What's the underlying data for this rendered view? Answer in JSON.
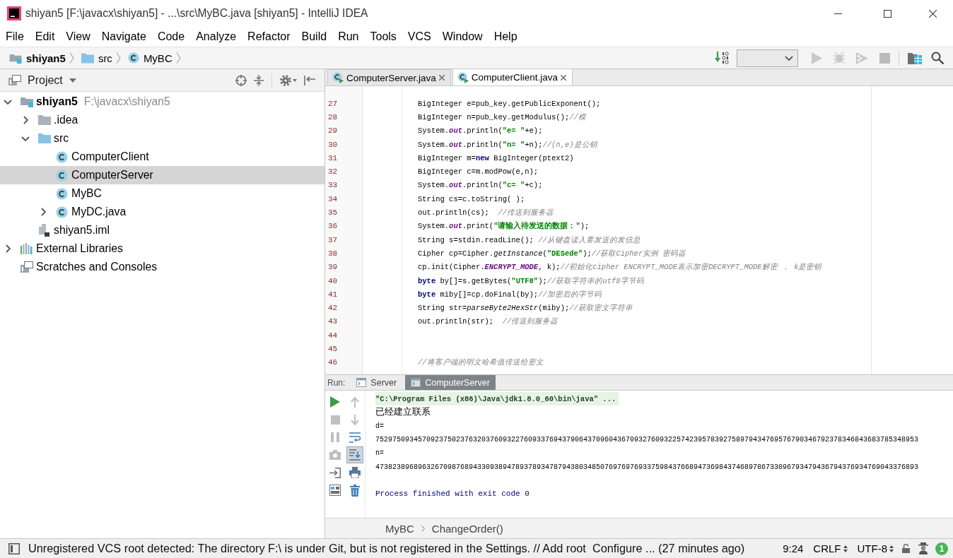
{
  "window": {
    "title": "shiyan5 [F:\\javacx\\shiyan5] - ...\\src\\MyBC.java [shiyan5] - IntelliJ IDEA"
  },
  "menu": [
    "File",
    "Edit",
    "View",
    "Navigate",
    "Code",
    "Analyze",
    "Refactor",
    "Build",
    "Run",
    "Tools",
    "VCS",
    "Window",
    "Help"
  ],
  "nav_bar": {
    "breadcrumbs": [
      {
        "label": "shiyan5",
        "kind": "module"
      },
      {
        "label": "src",
        "kind": "source_folder"
      },
      {
        "label": "MyBC",
        "kind": "class"
      }
    ],
    "toolbar": [
      {
        "kind": "build",
        "disabled": false
      },
      {
        "kind": "config",
        "disabled": false
      },
      {
        "kind": "run",
        "disabled": true
      },
      {
        "kind": "debug",
        "disabled": true
      },
      {
        "kind": "coverage",
        "disabled": true
      },
      {
        "kind": "stop",
        "disabled": true
      },
      {
        "kind": "structure",
        "disabled": false
      },
      {
        "kind": "search",
        "disabled": false
      }
    ]
  },
  "project_panel": {
    "title": "Project",
    "tree": [
      {
        "label": "shiyan5",
        "path": "F:\\javacx\\shiyan5",
        "kind": "module",
        "expanded": true,
        "selected": false,
        "children": [
          {
            "label": ".idea",
            "kind": "folder",
            "expanded": false,
            "selected": false
          },
          {
            "label": "src",
            "kind": "source_folder",
            "expanded": true,
            "selected": false,
            "children": [
              {
                "label": "ComputerClient",
                "kind": "class",
                "selected": false
              },
              {
                "label": "ComputerServer",
                "kind": "class",
                "selected": true
              },
              {
                "label": "MyBC",
                "kind": "class",
                "selected": false
              },
              {
                "label": "MyDC.java",
                "kind": "class",
                "expanded": false,
                "selected": false
              }
            ]
          },
          {
            "label": "shiyan5.iml",
            "kind": "module_file",
            "selected": false
          }
        ]
      },
      {
        "label": "External Libraries",
        "kind": "libraries",
        "expanded": false,
        "selected": false
      },
      {
        "label": "Scratches and Consoles",
        "kind": "scratches",
        "selected": false
      }
    ]
  },
  "editor": {
    "tabs": [
      {
        "label": "ComputerServer.java",
        "selected": false
      },
      {
        "label": "ComputerClient.java",
        "selected": true
      }
    ],
    "lines": [
      {
        "number": "27",
        "tokens": [
          {
            "kind": "plain",
            "text": "BigInteger e=pub_key.getPublicExponent();"
          }
        ]
      },
      {
        "number": "28",
        "tokens": [
          {
            "kind": "plain",
            "text": "BigInteger n=pub_key.getModulus();"
          },
          {
            "kind": "comment",
            "text": "//模"
          }
        ]
      },
      {
        "number": "29",
        "tokens": [
          {
            "kind": "plain",
            "text": "System."
          },
          {
            "kind": "field",
            "text": "out"
          },
          {
            "kind": "plain",
            "text": ".println("
          },
          {
            "kind": "string",
            "text": "\"e= \""
          },
          {
            "kind": "plain",
            "text": "+e);"
          }
        ]
      },
      {
        "number": "30",
        "tokens": [
          {
            "kind": "plain",
            "text": "System."
          },
          {
            "kind": "field",
            "text": "out"
          },
          {
            "kind": "plain",
            "text": ".println("
          },
          {
            "kind": "string",
            "text": "\"n= \""
          },
          {
            "kind": "plain",
            "text": "+n);"
          },
          {
            "kind": "comment",
            "text": "//(n,e)是公钥"
          }
        ]
      },
      {
        "number": "31",
        "tokens": [
          {
            "kind": "plain",
            "text": "BigInteger m="
          },
          {
            "kind": "keyword",
            "text": "new"
          },
          {
            "kind": "plain",
            "text": " BigInteger(ptext2)"
          }
        ]
      },
      {
        "number": "32",
        "tokens": [
          {
            "kind": "plain",
            "text": "BigInteger c=m.modPow(e,n);"
          }
        ]
      },
      {
        "number": "33",
        "tokens": [
          {
            "kind": "plain",
            "text": "System."
          },
          {
            "kind": "field",
            "text": "out"
          },
          {
            "kind": "plain",
            "text": ".println("
          },
          {
            "kind": "string",
            "text": "\"c= \""
          },
          {
            "kind": "plain",
            "text": "+c);"
          }
        ]
      },
      {
        "number": "34",
        "tokens": [
          {
            "kind": "plain",
            "text": "String cs=c.toString( );"
          }
        ]
      },
      {
        "number": "35",
        "tokens": [
          {
            "kind": "plain",
            "text": "out.println(cs);  "
          },
          {
            "kind": "comment",
            "text": "//传送到服务器"
          }
        ]
      },
      {
        "number": "36",
        "tokens": [
          {
            "kind": "plain",
            "text": "System."
          },
          {
            "kind": "field",
            "text": "out"
          },
          {
            "kind": "plain",
            "text": ".print("
          },
          {
            "kind": "string",
            "text": "\"请输入待发送的数据：\""
          },
          {
            "kind": "plain",
            "text": ");"
          }
        ]
      },
      {
        "number": "37",
        "tokens": [
          {
            "kind": "plain",
            "text": "String s=stdin.readLine(); "
          },
          {
            "kind": "comment",
            "text": "//从键盘读入要发送的发信息"
          }
        ]
      },
      {
        "number": "38",
        "tokens": [
          {
            "kind": "plain",
            "text": "Cipher cp=Cipher."
          },
          {
            "kind": "static",
            "text": "getInstance"
          },
          {
            "kind": "plain",
            "text": "("
          },
          {
            "kind": "string",
            "text": "\"DESede\""
          },
          {
            "kind": "plain",
            "text": ");"
          },
          {
            "kind": "comment",
            "text": "//获取Cipher实例 密码器"
          }
        ]
      },
      {
        "number": "39",
        "tokens": [
          {
            "kind": "plain",
            "text": "cp.init(Cipher."
          },
          {
            "kind": "field",
            "text": "ENCRYPT_MODE"
          },
          {
            "kind": "plain",
            "text": ", k);"
          },
          {
            "kind": "comment",
            "text": "//初始化cipher ENCRYPT_MODE表示加密DECRYPT_MODE解密 ， k是密钥"
          }
        ]
      },
      {
        "number": "40",
        "tokens": [
          {
            "kind": "keyword",
            "text": "byte"
          },
          {
            "kind": "plain",
            "text": " by[]=s.getBytes("
          },
          {
            "kind": "string",
            "text": "\"UTF8\""
          },
          {
            "kind": "plain",
            "text": ");"
          },
          {
            "kind": "comment",
            "text": "//获取字符串的utf8字节码"
          }
        ]
      },
      {
        "number": "41",
        "tokens": [
          {
            "kind": "keyword",
            "text": "byte"
          },
          {
            "kind": "plain",
            "text": " miby[]=cp.doFinal(by);"
          },
          {
            "kind": "comment",
            "text": "//加密后的字节码"
          }
        ]
      },
      {
        "number": "42",
        "tokens": [
          {
            "kind": "plain",
            "text": "String str="
          },
          {
            "kind": "static",
            "text": "parseByte2HexStr"
          },
          {
            "kind": "plain",
            "text": "(miby);"
          },
          {
            "kind": "comment",
            "text": "//获取密文字符串"
          }
        ]
      },
      {
        "number": "43",
        "tokens": [
          {
            "kind": "plain",
            "text": "out.println(str);  "
          },
          {
            "kind": "comment",
            "text": "//传送到服务器"
          }
        ]
      },
      {
        "number": "44"
      },
      {
        "number": "45"
      },
      {
        "number": "46",
        "tokens": [
          {
            "kind": "comment",
            "text": "//将客户端的明文哈希值传送给密文"
          }
        ]
      }
    ]
  },
  "run_panel": {
    "label": "Run:",
    "tabs": [
      {
        "label": "Server",
        "selected": false
      },
      {
        "label": "ComputerServer",
        "selected": true
      }
    ],
    "left_tools": [
      {
        "kind": "rerun",
        "disabled": false
      },
      {
        "kind": "stop",
        "disabled": true
      },
      {
        "kind": "pause",
        "disabled": true
      },
      {
        "kind": "dump",
        "disabled": true
      },
      {
        "kind": "restore",
        "disabled": false
      },
      {
        "kind": "layout",
        "disabled": false
      }
    ],
    "right_tools": [
      {
        "kind": "up",
        "disabled": true,
        "on": false
      },
      {
        "kind": "down",
        "disabled": true,
        "on": false
      },
      {
        "kind": "wrap",
        "disabled": false,
        "on": false
      },
      {
        "kind": "scroll_end",
        "disabled": false,
        "on": true
      },
      {
        "kind": "print",
        "disabled": false,
        "on": false
      },
      {
        "kind": "trash",
        "disabled": false,
        "on": false
      }
    ],
    "console": [
      {
        "kind": "command",
        "text": "\"C:\\Program Files (x86)\\Java\\jdk1.8.0_60\\bin\\java\" ..."
      },
      {
        "kind": "text",
        "text": "已经建立联系"
      },
      {
        "kind": "output",
        "text": "d="
      },
      {
        "kind": "output",
        "text": "75297509345709237502376320376093227609337694379064370960436709327609322574239578392758979434769576790346792378346843683785348953"
      },
      {
        "kind": "output",
        "text": "n="
      },
      {
        "kind": "output",
        "text": "47382389689632670987689433093894789378934787943803485076976976933759843766894736984374689786733096793479436794376934769043376893"
      },
      {
        "kind": "exit",
        "text": "Process finished with exit code 0"
      }
    ]
  },
  "breadcrumb_bar": {
    "items": [
      "MyBC",
      "ChangeOrder()"
    ]
  },
  "status_bar": {
    "message": "Unregistered VCS root detected: The directory F:\\ is under Git, but is not registered in the Settings. // Add root  Configure ... (27 minutes ago)",
    "position": "9:24",
    "line_separator": "CRLF",
    "encoding": "UTF-8",
    "notifications": "1"
  }
}
